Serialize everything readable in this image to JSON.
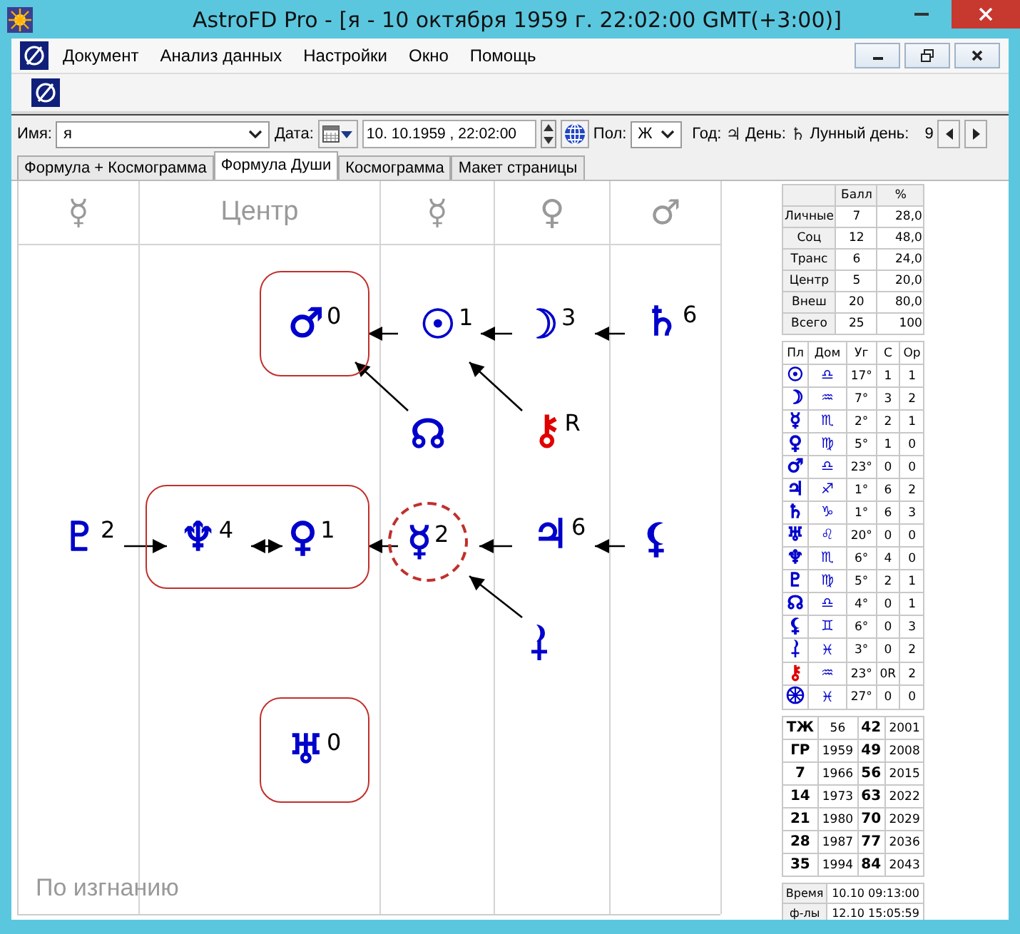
{
  "window": {
    "title": "AstroFD Pro - [я - 10 октября 1959 г. 22:02:00 GMT(+3:00)]"
  },
  "menu": [
    "Документ",
    "Анализ данных",
    "Настройки",
    "Окно",
    "Помощь"
  ],
  "form": {
    "name_label": "Имя:",
    "name_value": "я",
    "date_label": "Дата:",
    "date_value": "10. 10.1959 , 22:02:00",
    "sex_label": "Пол:",
    "sex_value": "Ж",
    "year_label": "Год:",
    "year_planet": "♃",
    "day_label": "День:",
    "day_planet": "♄",
    "lunar_day_label": "Лунный день:",
    "lunar_day": "9"
  },
  "tabs": [
    {
      "label": "Формула + Космограмма",
      "selected": false
    },
    {
      "label": "Формула Души",
      "selected": true
    },
    {
      "label": "Космограмма",
      "selected": false
    },
    {
      "label": "Макет страницы",
      "selected": false
    }
  ],
  "diagram": {
    "columns": [
      "☿",
      "Центр",
      "☿",
      "♀",
      "♂"
    ],
    "groups": [
      {
        "kind": "framed",
        "nodes": [
          {
            "kind": "glyph",
            "glyph": "♂",
            "number": "0",
            "color": "#0000cc"
          }
        ]
      },
      {
        "kind": "plain",
        "nodes": [
          {
            "kind": "glyph",
            "glyph": "☉",
            "number": "1",
            "color": "#0000cc"
          }
        ]
      },
      {
        "kind": "plain",
        "nodes": [
          {
            "kind": "glyph",
            "glyph": "☽",
            "number": "3",
            "color": "#0000cc"
          }
        ]
      },
      {
        "kind": "plain",
        "nodes": [
          {
            "kind": "glyph",
            "glyph": "♄",
            "number": "6",
            "color": "#0000cc"
          }
        ]
      },
      {
        "kind": "plain",
        "nodes": [
          {
            "kind": "glyph",
            "glyph": "☊",
            "color": "#0000cc"
          }
        ]
      },
      {
        "kind": "plain",
        "nodes": [
          {
            "kind": "glyph",
            "glyph": "⚷",
            "number": "R",
            "color": "#e00000"
          }
        ]
      },
      {
        "kind": "plain",
        "nodes": [
          {
            "kind": "glyph",
            "glyph": "♇",
            "number": "2",
            "color": "#0000cc"
          }
        ]
      },
      {
        "kind": "framed",
        "nodes": [
          {
            "kind": "glyph",
            "glyph": "♆",
            "number": "4",
            "color": "#0000cc"
          },
          {
            "kind": "glyph",
            "glyph": "♀",
            "number": "1",
            "color": "#0000cc"
          }
        ]
      },
      {
        "kind": "circled",
        "nodes": [
          {
            "kind": "glyph",
            "glyph": "☿",
            "number": "2",
            "color": "#0000cc"
          }
        ]
      },
      {
        "kind": "plain",
        "nodes": [
          {
            "kind": "glyph",
            "glyph": "♃",
            "number": "6",
            "color": "#0000cc"
          }
        ]
      },
      {
        "kind": "plain",
        "nodes": [
          {
            "kind": "glyph",
            "glyph": "⚸",
            "color": "#0000cc"
          }
        ]
      },
      {
        "kind": "plain",
        "nodes": [
          {
            "kind": "moon-cross",
            "color": "#0000cc"
          }
        ]
      },
      {
        "kind": "framed",
        "nodes": [
          {
            "kind": "glyph",
            "glyph": "♅",
            "number": "0",
            "color": "#0000cc"
          }
        ]
      }
    ],
    "arrows": [
      {
        "kind": "left"
      },
      {
        "kind": "left"
      },
      {
        "kind": "left"
      },
      {
        "kind": "up-left"
      },
      {
        "kind": "up-left"
      },
      {
        "kind": "right"
      },
      {
        "kind": "both"
      },
      {
        "kind": "left"
      },
      {
        "kind": "left"
      },
      {
        "kind": "left"
      },
      {
        "kind": "up-left"
      }
    ],
    "footer": "По изгнанию"
  },
  "score_table": {
    "columns": [
      "Балл",
      "%"
    ],
    "rows": [
      {
        "label": "Личные",
        "score": "7",
        "percent": "28,0"
      },
      {
        "label": "Соц",
        "score": "12",
        "percent": "48,0"
      },
      {
        "label": "Транс",
        "score": "6",
        "percent": "24,0"
      },
      {
        "label": "Центр",
        "score": "5",
        "percent": "20,0"
      },
      {
        "label": "Внеш",
        "score": "20",
        "percent": "80,0"
      },
      {
        "label": "Всего",
        "score": "25",
        "percent": "100"
      }
    ]
  },
  "planet_table": {
    "columns": [
      "Пл",
      "Дом",
      "Уг",
      "С",
      "Ор"
    ],
    "rows": [
      {
        "kind": "glyph",
        "planet": "☉",
        "color": "#0000cc",
        "sign": "♎",
        "degree": "17°",
        "c": "1",
        "or": "1"
      },
      {
        "kind": "glyph",
        "planet": "☽",
        "color": "#0000cc",
        "sign": "♒",
        "degree": "7°",
        "c": "3",
        "or": "2"
      },
      {
        "kind": "glyph",
        "planet": "☿",
        "color": "#0000cc",
        "sign": "♏",
        "degree": "2°",
        "c": "2",
        "or": "1"
      },
      {
        "kind": "glyph",
        "planet": "♀",
        "color": "#0000cc",
        "sign": "♍",
        "degree": "5°",
        "c": "1",
        "or": "0"
      },
      {
        "kind": "glyph",
        "planet": "♂",
        "color": "#0000cc",
        "sign": "♎",
        "degree": "23°",
        "c": "0",
        "or": "0"
      },
      {
        "kind": "glyph",
        "planet": "♃",
        "color": "#0000cc",
        "sign": "♐",
        "degree": "1°",
        "c": "6",
        "or": "2"
      },
      {
        "kind": "glyph",
        "planet": "♄",
        "color": "#0000cc",
        "sign": "♑",
        "degree": "1°",
        "c": "6",
        "or": "3"
      },
      {
        "kind": "glyph",
        "planet": "♅",
        "color": "#0000cc",
        "sign": "♌",
        "degree": "20°",
        "c": "0",
        "or": "0"
      },
      {
        "kind": "glyph",
        "planet": "♆",
        "color": "#0000cc",
        "sign": "♏",
        "degree": "6°",
        "c": "4",
        "or": "0"
      },
      {
        "kind": "glyph",
        "planet": "♇",
        "color": "#0000cc",
        "sign": "♍",
        "degree": "5°",
        "c": "2",
        "or": "1"
      },
      {
        "kind": "glyph",
        "planet": "☊",
        "color": "#0000cc",
        "sign": "♎",
        "degree": "4°",
        "c": "0",
        "or": "1"
      },
      {
        "kind": "glyph",
        "planet": "⚸",
        "color": "#0000cc",
        "sign": "♊",
        "degree": "6°",
        "c": "0",
        "or": "3"
      },
      {
        "kind": "moon-cross",
        "color": "#0000cc",
        "sign": "♓",
        "degree": "3°",
        "c": "0",
        "or": "2"
      },
      {
        "kind": "glyph",
        "planet": "⚷",
        "color": "#e00000",
        "sign": "♒",
        "degree": "23°",
        "c": "0R",
        "or": "2"
      },
      {
        "kind": "wheel",
        "color": "#0000cc",
        "sign": "♓",
        "degree": "27°",
        "c": "0",
        "or": "0"
      }
    ]
  },
  "cycle_table": {
    "rows": [
      [
        "ТЖ",
        "56",
        "42",
        "2001"
      ],
      [
        "ГР",
        "1959",
        "49",
        "2008"
      ],
      [
        "7",
        "1966",
        "56",
        "2015"
      ],
      [
        "14",
        "1973",
        "63",
        "2022"
      ],
      [
        "21",
        "1980",
        "70",
        "2029"
      ],
      [
        "28",
        "1987",
        "77",
        "2036"
      ],
      [
        "35",
        "1994",
        "84",
        "2043"
      ]
    ]
  },
  "time_table": {
    "rows": [
      {
        "label": "Время",
        "value": "10.10 09:13:00"
      },
      {
        "label": "ф-лы",
        "value": "12.10 15:05:59"
      }
    ]
  }
}
